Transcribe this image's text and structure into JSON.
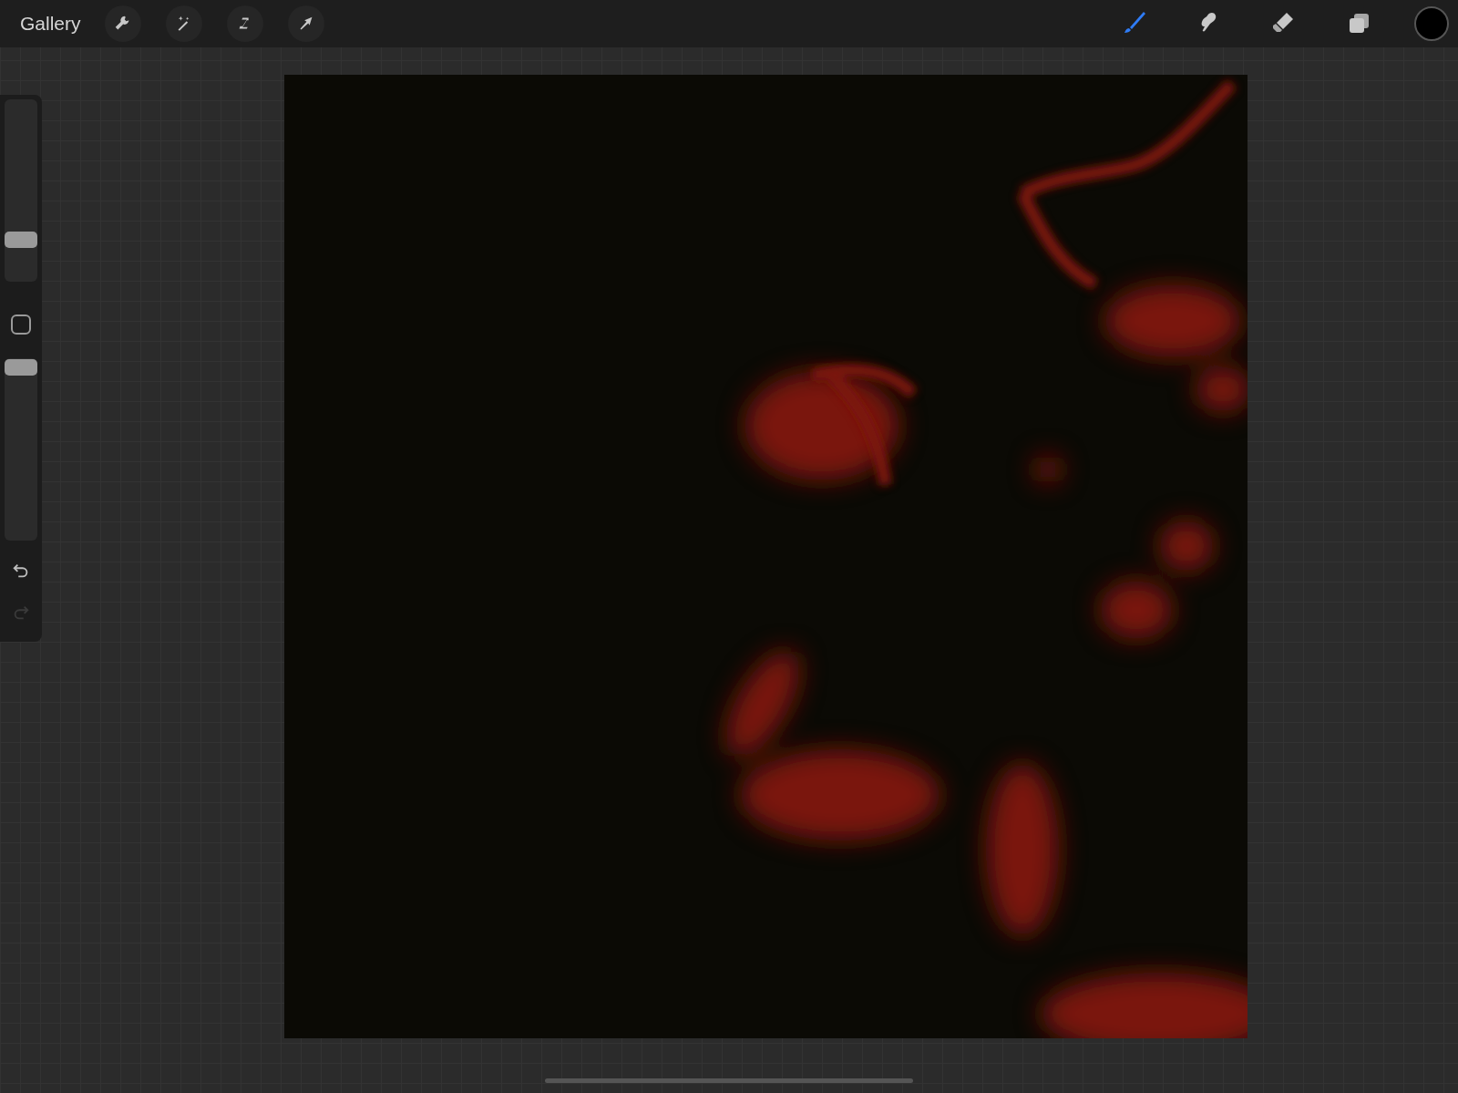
{
  "toolbar": {
    "gallery": "Gallery",
    "tools": [
      {
        "kind": "wrench"
      },
      {
        "kind": "wand"
      },
      {
        "kind": "selection"
      },
      {
        "kind": "transform"
      }
    ],
    "paint_tools": [
      {
        "kind": "brush",
        "selected": true
      },
      {
        "kind": "smudge",
        "selected": false
      },
      {
        "kind": "eraser",
        "selected": false
      },
      {
        "kind": "layers",
        "selected": false
      }
    ]
  },
  "sidebar": {
    "brush_size": {
      "level": 0.23
    },
    "opacity": {
      "level": 0.95
    },
    "undo": {
      "disabled": false
    },
    "redo": {
      "disabled": true
    }
  }
}
